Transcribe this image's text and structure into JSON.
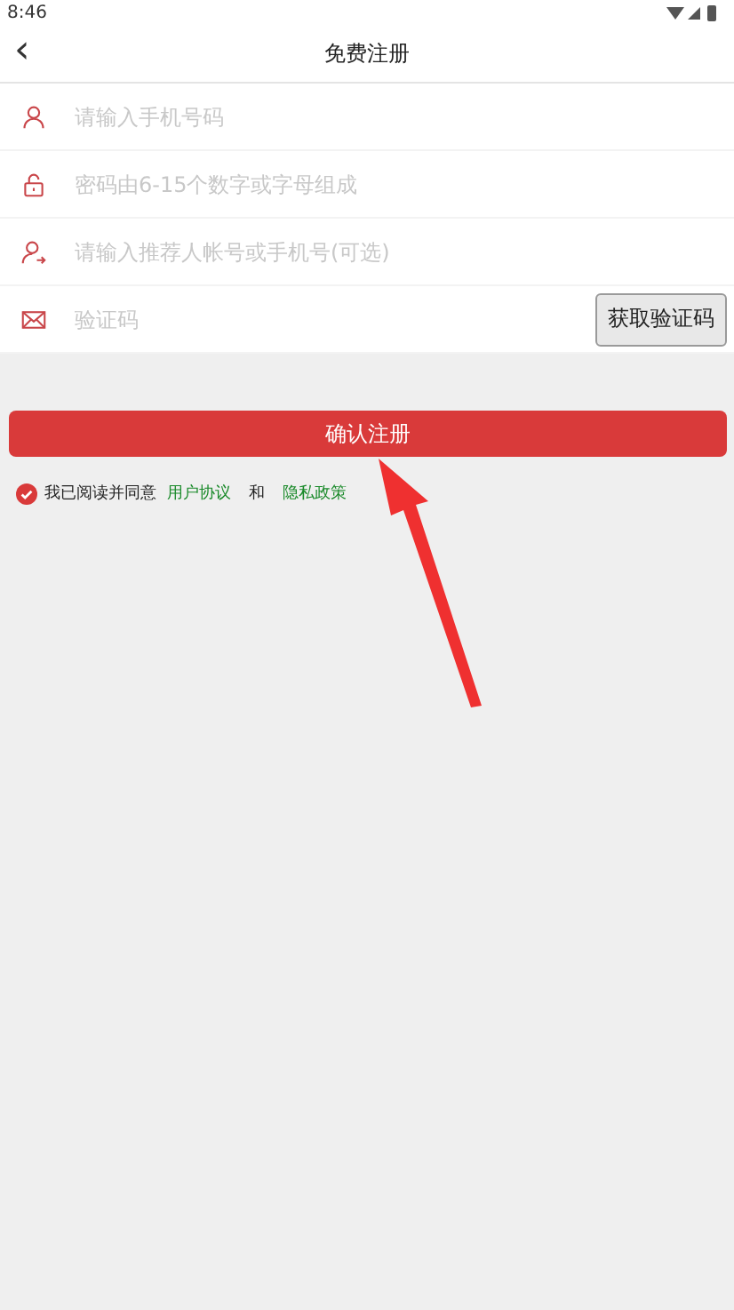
{
  "status_bar": {
    "time": "8:46"
  },
  "header": {
    "back": "‹",
    "title": "免费注册"
  },
  "fields": [
    {
      "kind": "text",
      "placeholder": "请输入手机号码"
    },
    {
      "kind": "text",
      "placeholder": "密码由6-15个数字或字母组成"
    },
    {
      "kind": "text",
      "placeholder": "请输入推荐人帐号或手机号(可选)"
    },
    {
      "kind": "code",
      "placeholder": "验证码",
      "button": "获取验证码"
    }
  ],
  "submit": "确认注册",
  "agreement": {
    "checked": true,
    "text": "我已阅读并同意",
    "link_1": "用户协议",
    "joiner": "和",
    "link_2": "隐私政策"
  }
}
